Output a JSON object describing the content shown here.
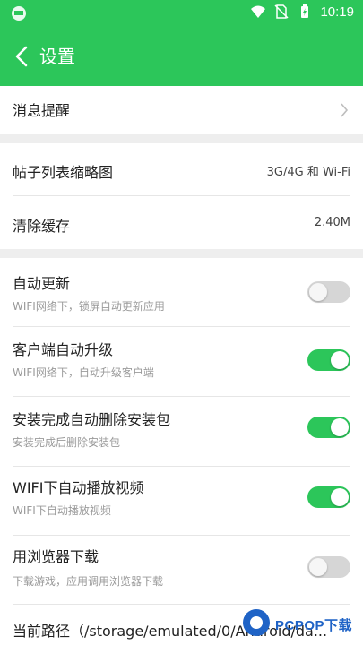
{
  "status_bar": {
    "time": "10:19"
  },
  "app_bar": {
    "title": "设置"
  },
  "settings": {
    "message_reminder": {
      "title": "消息提醒"
    },
    "thumbnail": {
      "title": "帖子列表缩略图",
      "value": "3G/4G 和 Wi-Fi"
    },
    "clear_cache": {
      "title": "清除缓存",
      "value": "2.40M"
    },
    "auto_update": {
      "title": "自动更新",
      "subtitle": "WIFI网络下，锁屏自动更新应用",
      "enabled": false
    },
    "client_upgrade": {
      "title": "客户端自动升级",
      "subtitle": "WIFI网络下，自动升级客户端",
      "enabled": true
    },
    "delete_package": {
      "title": "安装完成自动删除安装包",
      "subtitle": "安装完成后删除安装包",
      "enabled": true
    },
    "auto_play_video": {
      "title": "WIFI下自动播放视频",
      "subtitle": "WIFI下自动播放视频",
      "enabled": true
    },
    "browser_download": {
      "title": "用浏览器下载",
      "subtitle": "下载游戏，应用调用浏览器下载",
      "enabled": false
    },
    "current_path": {
      "title": "当前路径（/storage/emulated/0/Android/da..."
    }
  },
  "watermark": {
    "text": "PCPOP下载"
  },
  "colors": {
    "accent": "#2cc65a",
    "toggle_off": "#d6d6d6",
    "watermark": "#1f63c6"
  }
}
